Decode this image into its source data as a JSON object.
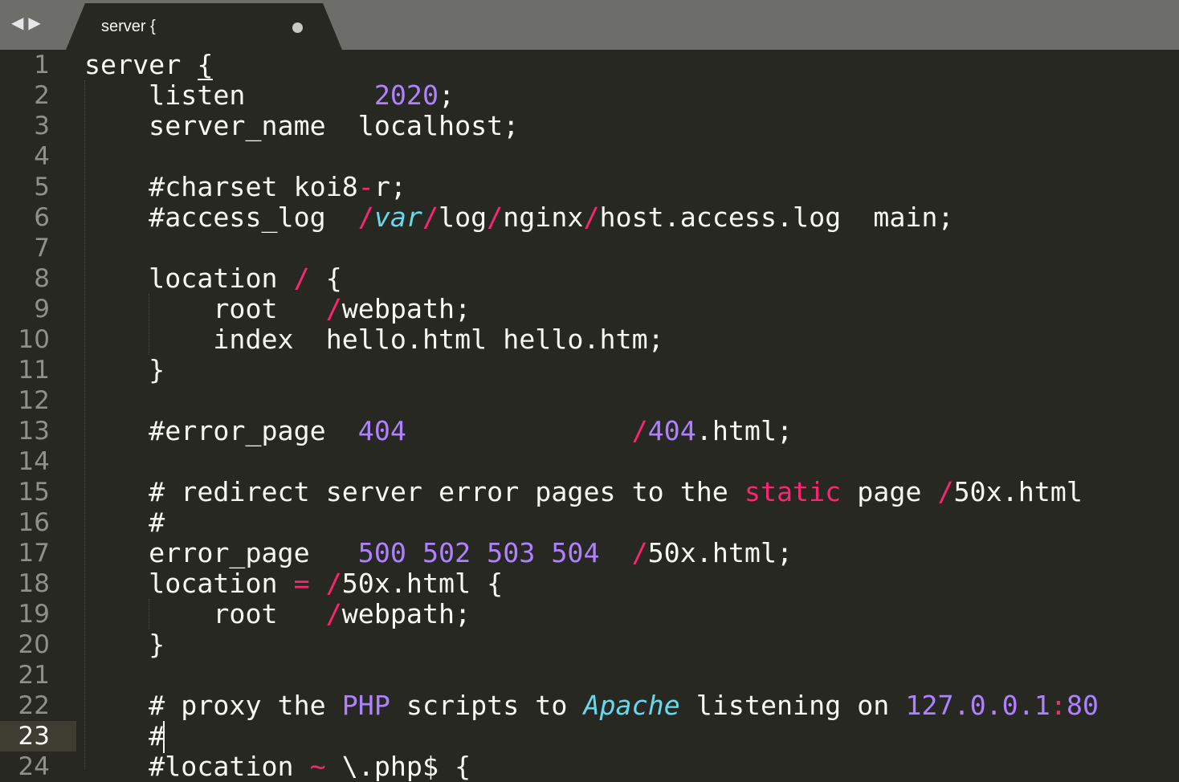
{
  "window": {
    "back_glyph": "◀",
    "forward_glyph": "▶"
  },
  "tab": {
    "title": "server {",
    "dirty_indicator": "●"
  },
  "editor": {
    "current_line": "23",
    "line_numbers": [
      "1",
      "2",
      "3",
      "4",
      "5",
      "6",
      "7",
      "8",
      "9",
      "10",
      "11",
      "12",
      "13",
      "14",
      "15",
      "16",
      "17",
      "18",
      "19",
      "20",
      "21",
      "22",
      "23",
      "24"
    ],
    "lines": [
      [
        {
          "t": "server {"
        }
      ],
      [
        {
          "t": "    listen        "
        },
        {
          "t": "2020",
          "c": "num"
        },
        {
          "t": ";"
        }
      ],
      [
        {
          "t": "    server_name  localhost;"
        }
      ],
      [],
      [
        {
          "t": "    #charset koi8"
        },
        {
          "t": "-",
          "c": "kw"
        },
        {
          "t": "r;"
        }
      ],
      [
        {
          "t": "    #access_log  "
        },
        {
          "t": "/",
          "c": "kw"
        },
        {
          "t": "var",
          "c": "it"
        },
        {
          "t": "/",
          "c": "kw"
        },
        {
          "t": "log"
        },
        {
          "t": "/",
          "c": "kw"
        },
        {
          "t": "nginx"
        },
        {
          "t": "/",
          "c": "kw"
        },
        {
          "t": "host.access.log  main;"
        }
      ],
      [],
      [
        {
          "t": "    location "
        },
        {
          "t": "/",
          "c": "kw"
        },
        {
          "t": " {"
        }
      ],
      [
        {
          "t": "        root   "
        },
        {
          "t": "/",
          "c": "kw"
        },
        {
          "t": "webpath;"
        }
      ],
      [
        {
          "t": "        index  hello.html hello.htm;"
        }
      ],
      [
        {
          "t": "    }"
        }
      ],
      [],
      [
        {
          "t": "    #error_page  "
        },
        {
          "t": "404",
          "c": "num"
        },
        {
          "t": "              "
        },
        {
          "t": "/",
          "c": "kw"
        },
        {
          "t": "404",
          "c": "num"
        },
        {
          "t": ".html;"
        }
      ],
      [],
      [
        {
          "t": "    # redirect server error pages to the "
        },
        {
          "t": "static",
          "c": "kw"
        },
        {
          "t": " page "
        },
        {
          "t": "/",
          "c": "kw"
        },
        {
          "t": "50x.html"
        }
      ],
      [
        {
          "t": "    #"
        }
      ],
      [
        {
          "t": "    error_page   "
        },
        {
          "t": "500",
          "c": "num"
        },
        {
          "t": " "
        },
        {
          "t": "502",
          "c": "num"
        },
        {
          "t": " "
        },
        {
          "t": "503",
          "c": "num"
        },
        {
          "t": " "
        },
        {
          "t": "504",
          "c": "num"
        },
        {
          "t": "  "
        },
        {
          "t": "/",
          "c": "kw"
        },
        {
          "t": "50x.html;"
        }
      ],
      [
        {
          "t": "    location "
        },
        {
          "t": "=",
          "c": "kw"
        },
        {
          "t": " "
        },
        {
          "t": "/",
          "c": "kw"
        },
        {
          "t": "50x.html {"
        }
      ],
      [
        {
          "t": "        root   "
        },
        {
          "t": "/",
          "c": "kw"
        },
        {
          "t": "webpath;"
        }
      ],
      [
        {
          "t": "    }"
        }
      ],
      [],
      [
        {
          "t": "    # proxy the "
        },
        {
          "t": "PHP",
          "c": "num"
        },
        {
          "t": " scripts to "
        },
        {
          "t": "Apache",
          "c": "it"
        },
        {
          "t": " listening on "
        },
        {
          "t": "127.0.0.1",
          "c": "num"
        },
        {
          "t": ":",
          "c": "kw"
        },
        {
          "t": "80",
          "c": "num"
        }
      ],
      [
        {
          "t": "    #"
        }
      ],
      [
        {
          "t": "    #location "
        },
        {
          "t": "~",
          "c": "kw"
        },
        {
          "t": " \\.php$ {"
        }
      ]
    ]
  }
}
